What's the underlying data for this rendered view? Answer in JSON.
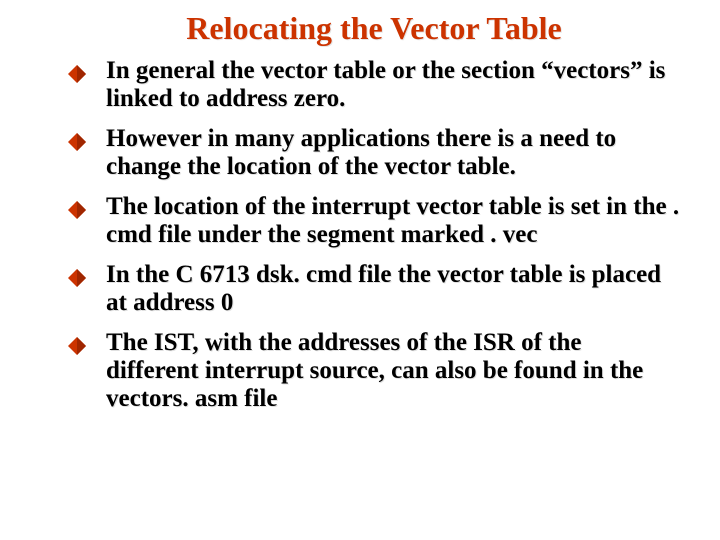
{
  "title": "Relocating the Vector Table",
  "bullet_icon_name": "diamond-bullet-icon",
  "bullets": [
    "In general the vector table or the section “vectors” is linked to address zero.",
    "However in many applications there is a need to change the location of the vector table.",
    "The location of the interrupt vector table is set in the . cmd file under the segment marked . vec",
    "In the C 6713 dsk. cmd file the vector table is placed at address 0",
    "The IST, with the addresses of the ISR of the different interrupt source, can also be found in the vectors. asm file"
  ]
}
